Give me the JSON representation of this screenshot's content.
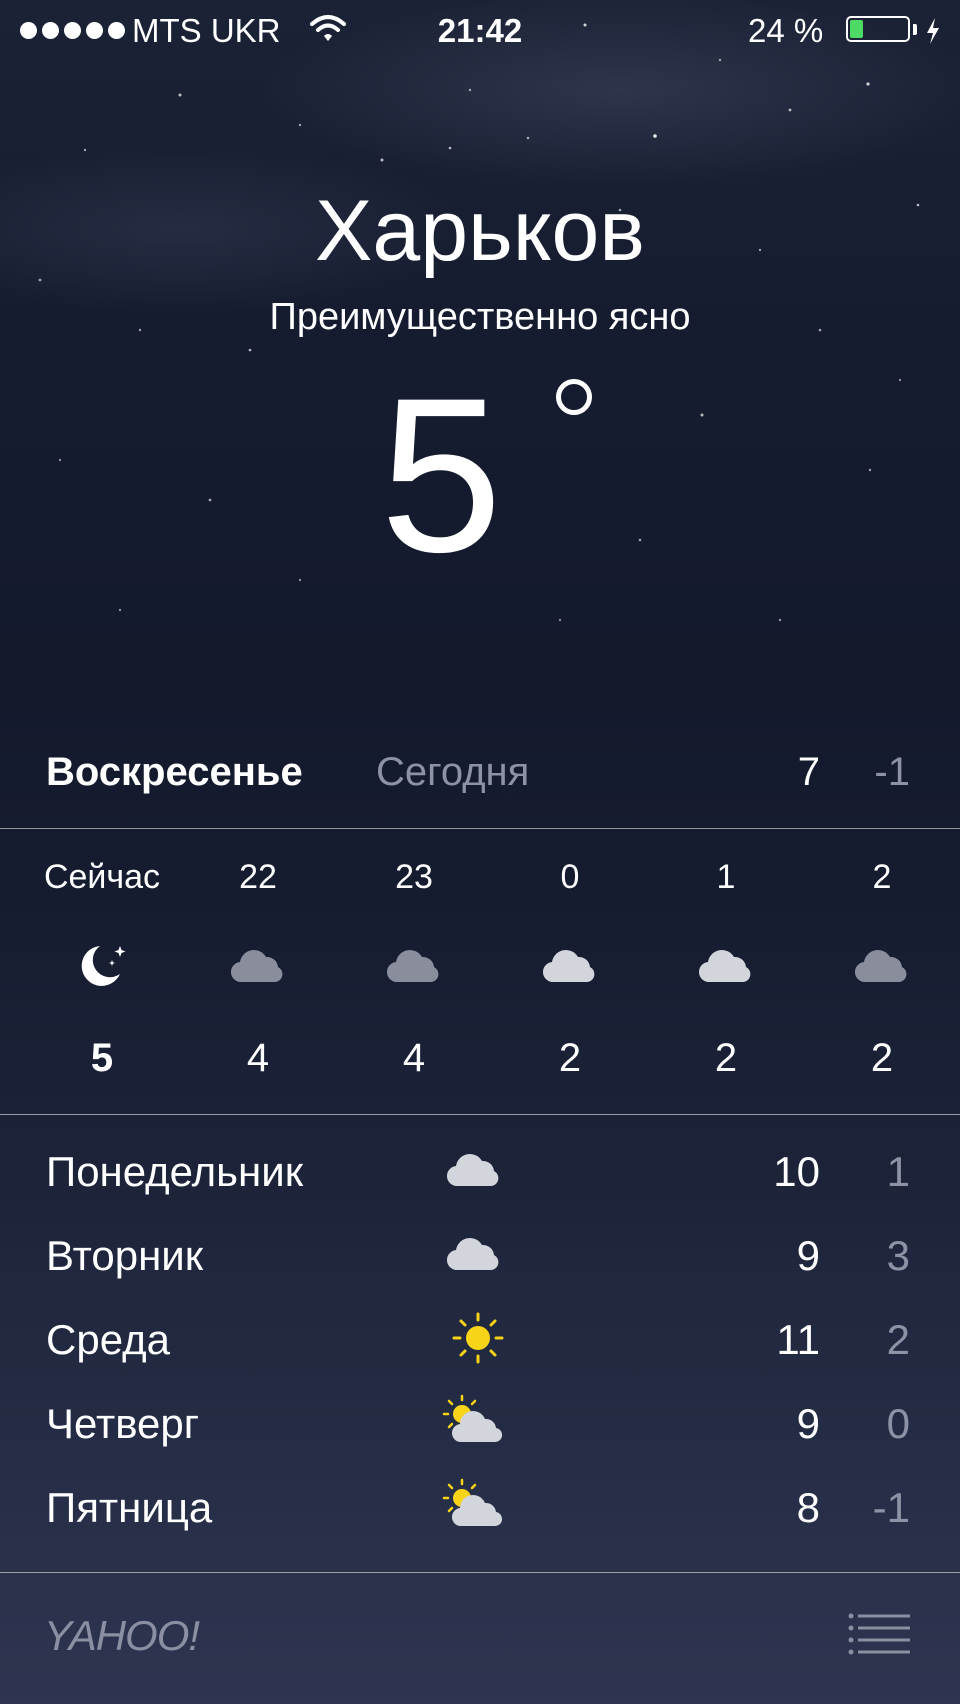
{
  "status_bar": {
    "carrier": "MTS UKR",
    "time": "21:42",
    "battery_percent": "24 %",
    "battery_level": 0.24,
    "signal_dots": 5
  },
  "location": {
    "city": "Харьков",
    "condition": "Преимущественно ясно",
    "temperature": "5"
  },
  "today": {
    "day": "Воскресенье",
    "label": "Сегодня",
    "high": "7",
    "low": "-1"
  },
  "hourly": [
    {
      "time": "Сейчас",
      "icon": "moon-icon",
      "temp": "5"
    },
    {
      "time": "22",
      "icon": "cloud-icon",
      "temp": "4"
    },
    {
      "time": "23",
      "icon": "cloud-icon",
      "temp": "4"
    },
    {
      "time": "0",
      "icon": "cloud-icon",
      "temp": "2"
    },
    {
      "time": "1",
      "icon": "cloud-icon",
      "temp": "2"
    },
    {
      "time": "2",
      "icon": "cloud-icon",
      "temp": "2"
    }
  ],
  "daily": [
    {
      "day": "Понедельник",
      "icon": "cloud-icon",
      "high": "10",
      "low": "1"
    },
    {
      "day": "Вторник",
      "icon": "cloud-icon",
      "high": "9",
      "low": "3"
    },
    {
      "day": "Среда",
      "icon": "sun-icon",
      "high": "11",
      "low": "2"
    },
    {
      "day": "Четверг",
      "icon": "partly-sunny-icon",
      "high": "9",
      "low": "0"
    },
    {
      "day": "Пятница",
      "icon": "partly-sunny-icon",
      "high": "8",
      "low": "-1"
    }
  ],
  "footer": {
    "provider": "YAHOO!",
    "menu_icon": "list-icon"
  },
  "colors": {
    "secondary_text": "#8d93a5",
    "battery_fill": "#4cd964",
    "sun": "#f7d417"
  }
}
